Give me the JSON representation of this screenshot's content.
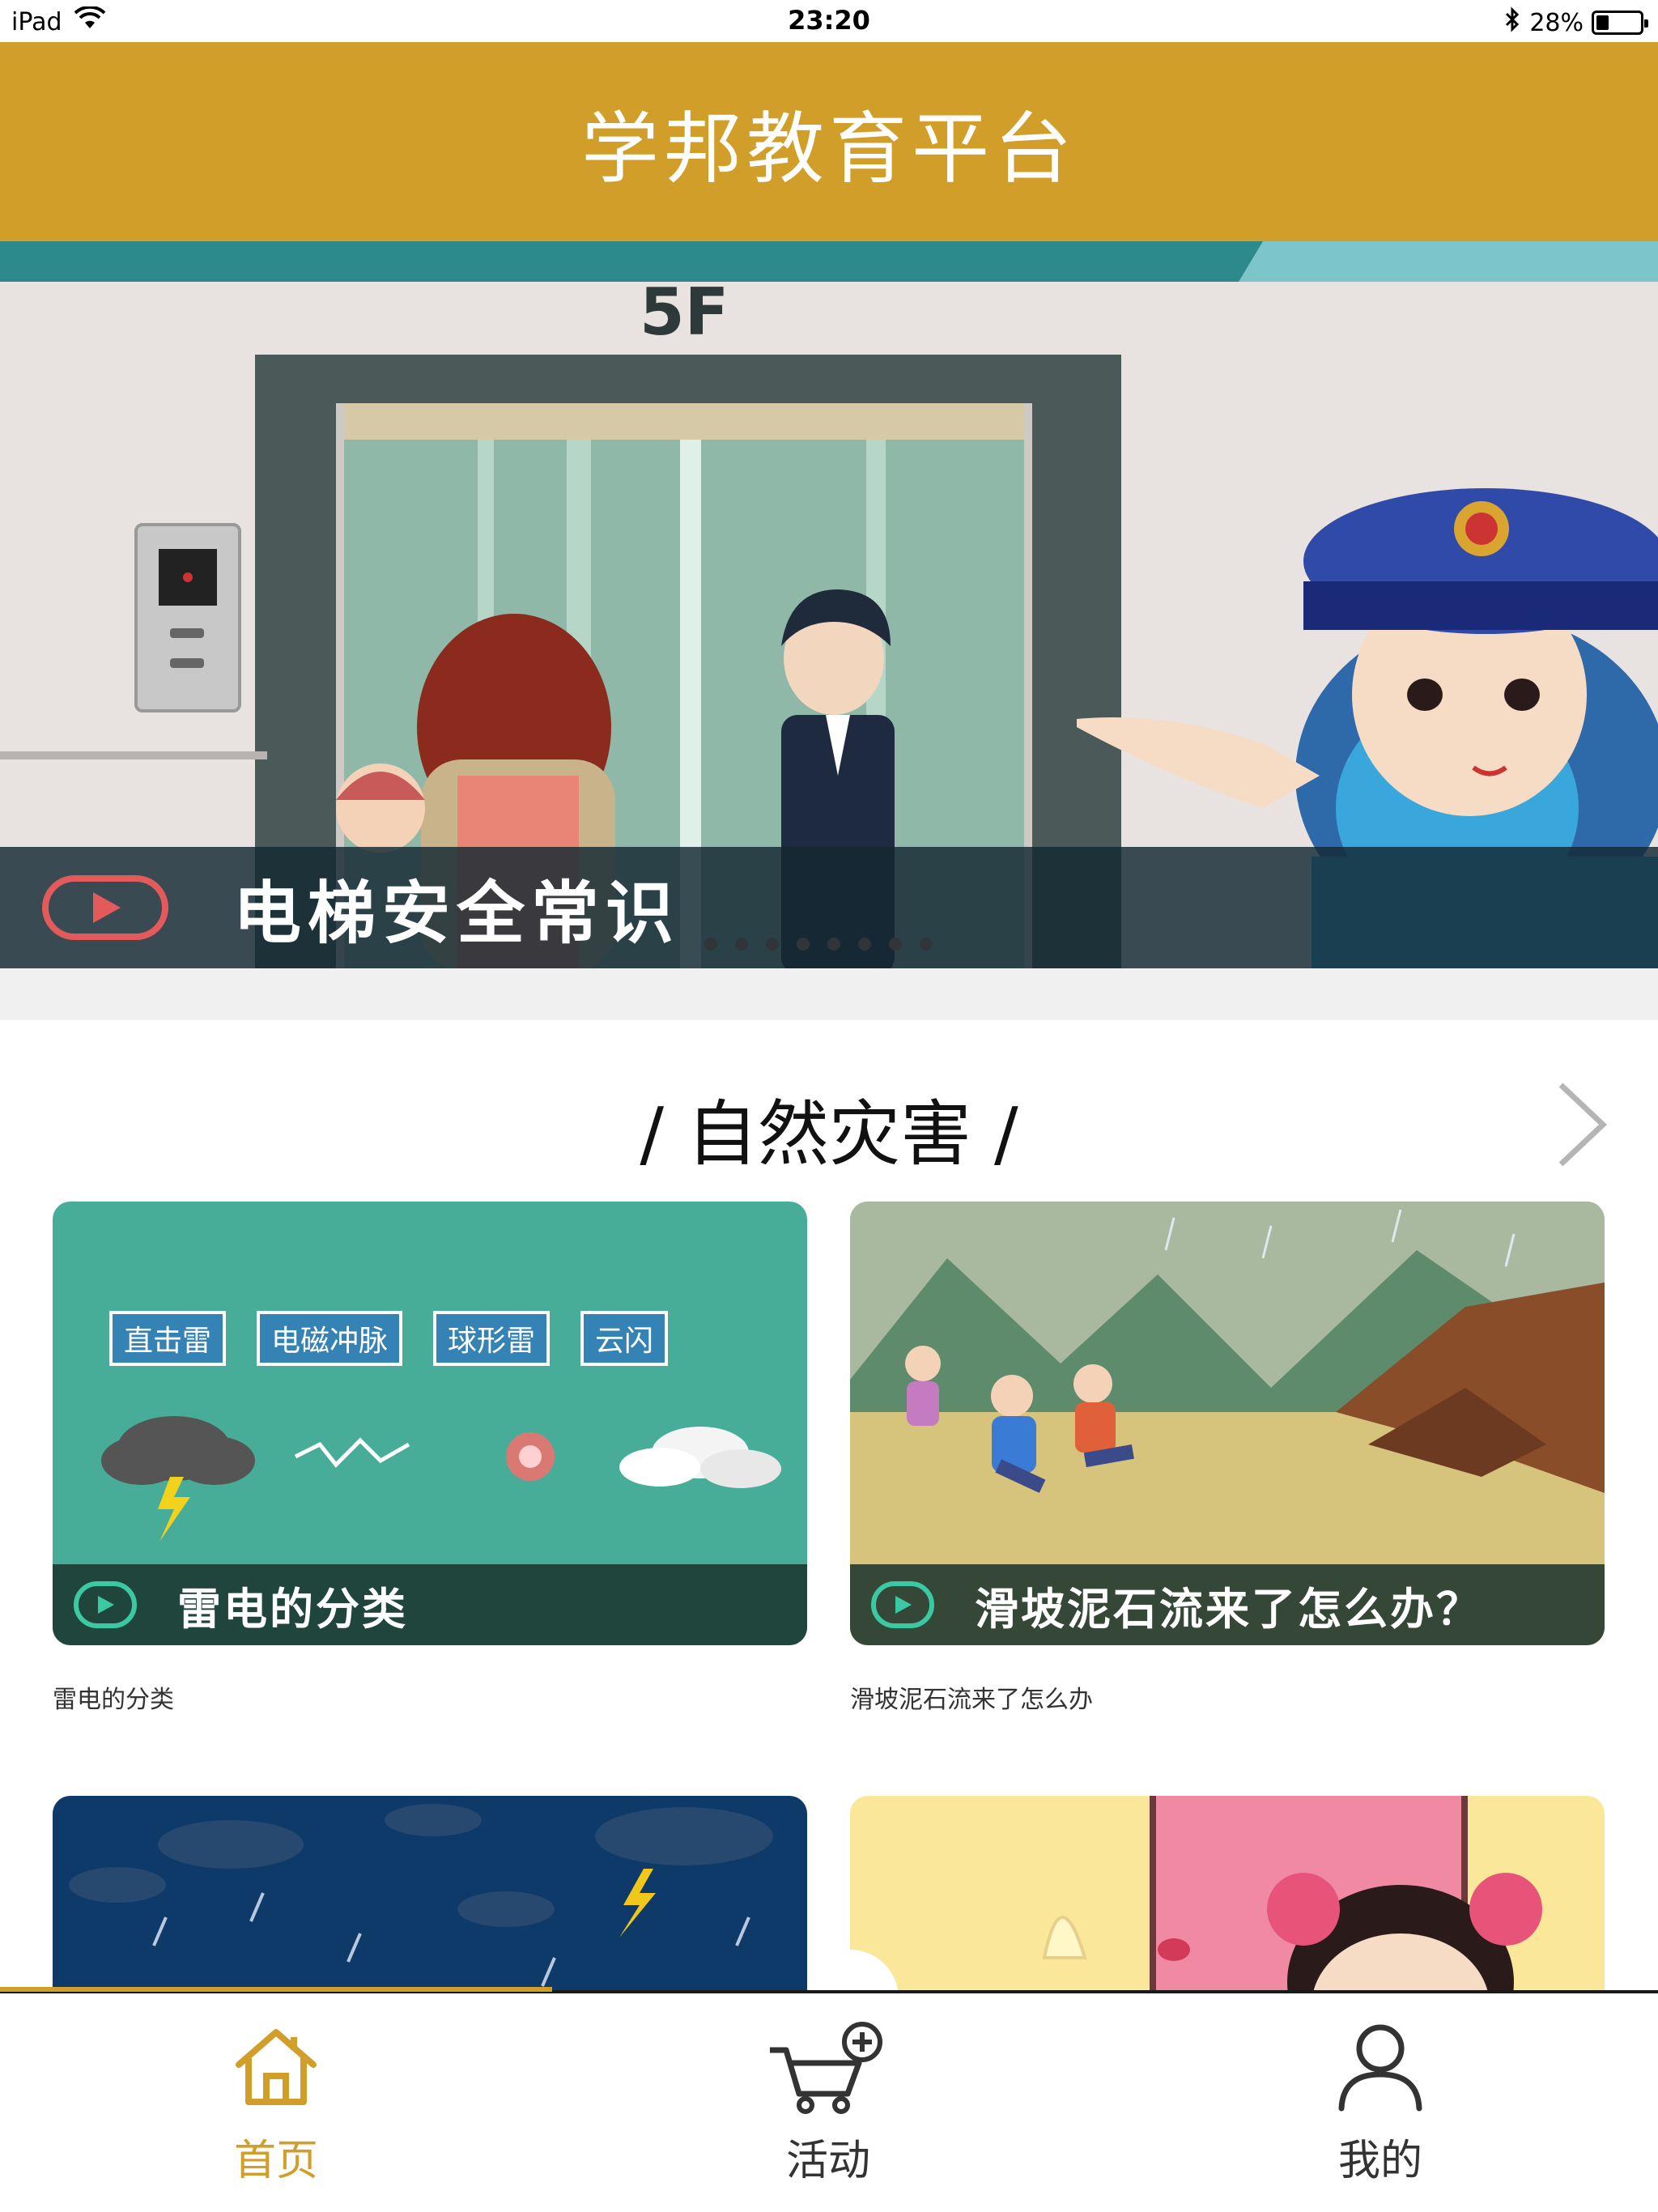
{
  "status_bar": {
    "device": "iPad",
    "time": "23:20",
    "battery": "28%",
    "battery_level": 0.28
  },
  "header": {
    "title": "学邦教育平台"
  },
  "banner": {
    "title": "电梯安全常识",
    "floor_sign": "5F",
    "dot_count": 8
  },
  "section": {
    "title": "/ 自然灾害 /"
  },
  "cards": [
    {
      "thumb_title": "雷电的分类",
      "label": "雷电的分类",
      "tags": [
        "直击雷",
        "电磁冲脉",
        "球形雷",
        "云闪"
      ]
    },
    {
      "thumb_title": "滑坡泥石流来了怎么办？",
      "label": "滑坡泥石流来了怎么办"
    }
  ],
  "tabs": [
    {
      "label": "首页",
      "icon": "home-icon",
      "active": true
    },
    {
      "label": "活动",
      "icon": "cart-plus-icon",
      "active": false
    },
    {
      "label": "我的",
      "icon": "user-icon",
      "active": false
    }
  ],
  "colors": {
    "brand": "#d19e29",
    "tab_inactive": "#333333"
  }
}
